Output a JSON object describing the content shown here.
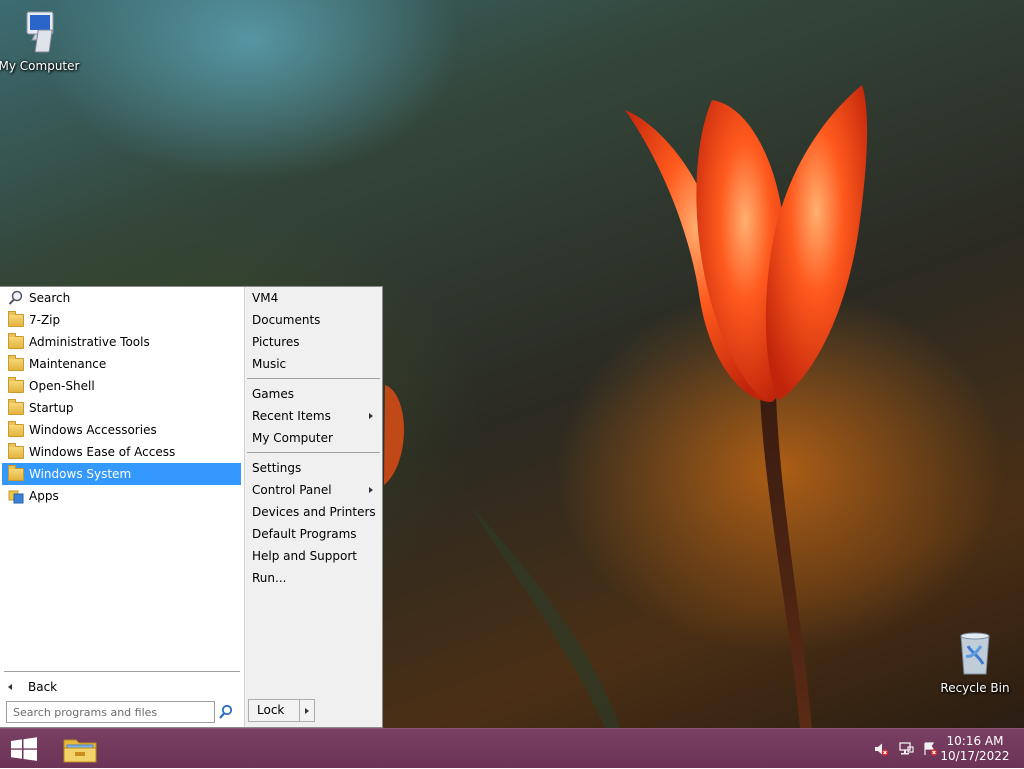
{
  "desktop": {
    "icons": [
      {
        "label": "My Computer",
        "icon": "computer-icon"
      },
      {
        "label": "Recycle Bin",
        "icon": "recycle-bin-icon"
      }
    ]
  },
  "start_menu": {
    "programs": [
      {
        "label": "Search",
        "icon": "search-icon"
      },
      {
        "label": "7-Zip",
        "icon": "folder-icon"
      },
      {
        "label": "Administrative Tools",
        "icon": "folder-icon"
      },
      {
        "label": "Maintenance",
        "icon": "folder-icon"
      },
      {
        "label": "Open-Shell",
        "icon": "folder-icon"
      },
      {
        "label": "Startup",
        "icon": "folder-icon"
      },
      {
        "label": "Windows Accessories",
        "icon": "folder-icon"
      },
      {
        "label": "Windows Ease of Access",
        "icon": "folder-icon"
      },
      {
        "label": "Windows System",
        "icon": "folder-icon",
        "selected": true
      },
      {
        "label": "Apps",
        "icon": "apps-icon"
      }
    ],
    "back_label": "Back",
    "search_placeholder": "Search programs and files",
    "places": [
      {
        "label": "VM4"
      },
      {
        "label": "Documents"
      },
      {
        "label": "Pictures"
      },
      {
        "label": "Music"
      },
      {
        "label": "Games"
      },
      {
        "label": "Recent Items",
        "submenu": true
      },
      {
        "label": "My Computer"
      },
      {
        "label": "Settings"
      },
      {
        "label": "Control Panel",
        "submenu": true
      },
      {
        "label": "Devices and Printers"
      },
      {
        "label": "Default Programs"
      },
      {
        "label": "Help and Support"
      },
      {
        "label": "Run..."
      }
    ],
    "lock_label": "Lock"
  },
  "taskbar": {
    "tray_icons": [
      "speaker-muted-icon",
      "network-icon",
      "action-center-icon"
    ],
    "time": "10:16 AM",
    "date": "10/17/2022"
  },
  "colors": {
    "selection": "#3399ff",
    "taskbar": "#6b3456"
  }
}
